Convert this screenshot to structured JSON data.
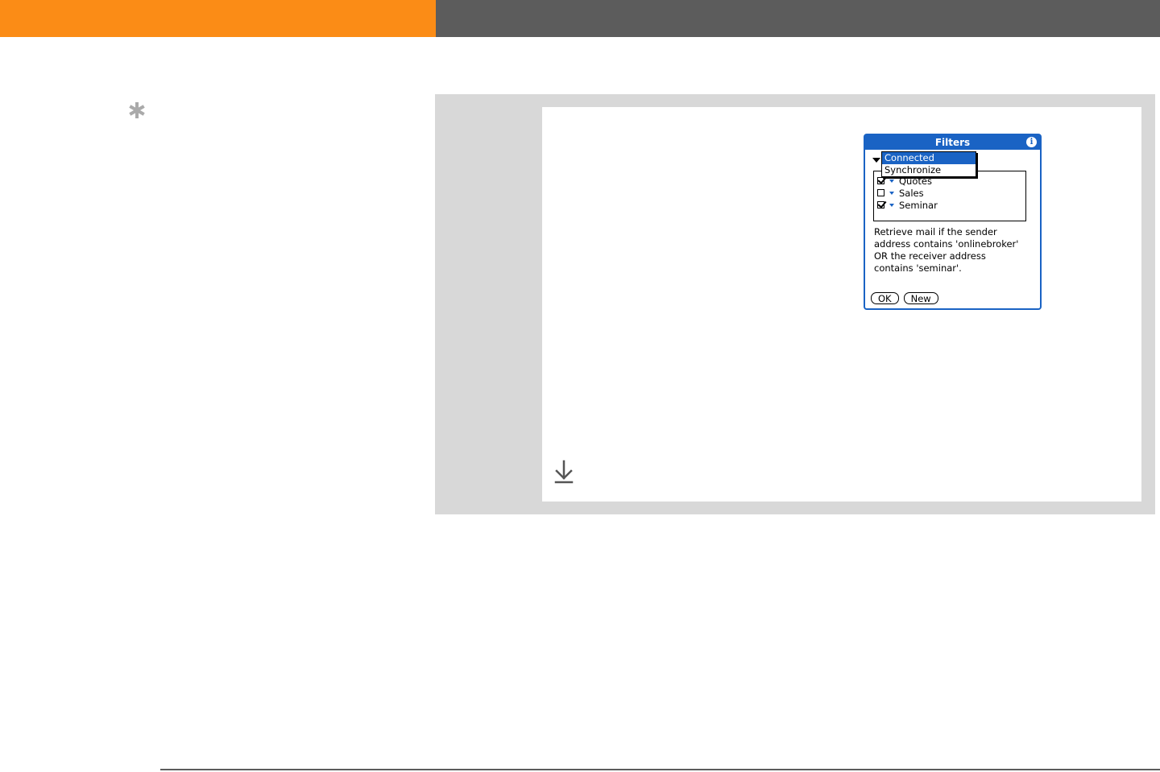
{
  "colors": {
    "accent_orange": "#fb8c16",
    "header_gray": "#5c5c5c",
    "panel_gray": "#d8d8d8",
    "palm_blue": "#1a63c4"
  },
  "icons": {
    "tip": "asterisk-icon",
    "continue": "arrow-down-to-line-icon",
    "info": "info-icon"
  },
  "dialog": {
    "title": "Filters",
    "info_glyph": "i",
    "popup_options": [
      {
        "label": "Connected",
        "selected": true
      },
      {
        "label": "Synchronize",
        "selected": false
      }
    ],
    "filters": [
      {
        "name": "Quotes",
        "checked": true
      },
      {
        "name": "Sales",
        "checked": false
      },
      {
        "name": "Seminar",
        "checked": true
      }
    ],
    "description_lines": [
      "Retrieve mail if the sender",
      "address  contains 'onlinebroker'",
      "OR the receiver address",
      "contains 'seminar'."
    ],
    "buttons": {
      "ok": "OK",
      "new": "New"
    }
  }
}
